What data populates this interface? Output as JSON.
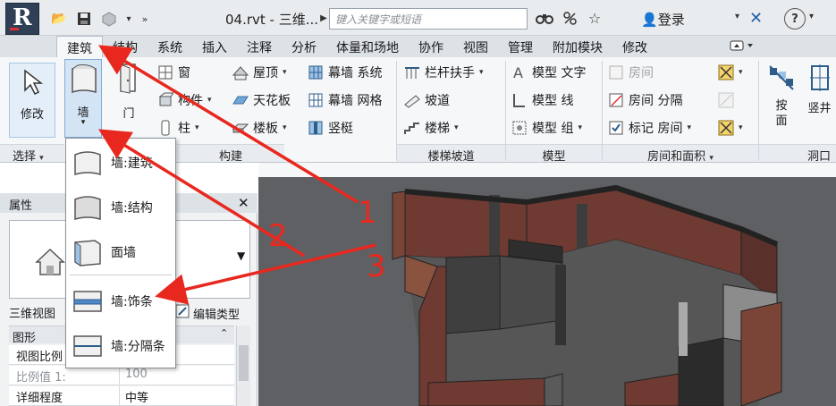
{
  "titlebar": {
    "logo_letter": "R",
    "doc_title": "04.rvt - 三维...",
    "search_placeholder": "键入关键字或短语",
    "login_label": "登录",
    "help_label": "?"
  },
  "tabs": [
    "建筑",
    "结构",
    "系统",
    "插入",
    "注释",
    "分析",
    "体量和场地",
    "协作",
    "视图",
    "管理",
    "附加模块",
    "修改"
  ],
  "active_tab": "建筑",
  "ribbon": {
    "modify_label": "修改",
    "wall_label": "墙",
    "door_label": "门",
    "build_items": {
      "window": "窗",
      "component": "构件",
      "column": "柱",
      "roof": "屋顶",
      "ceiling": "天花板",
      "floor": "楼板",
      "curtain_system": "幕墙 系统",
      "curtain_grid": "幕墙 网格",
      "mullion": "竖梃"
    },
    "stair_items": {
      "railing": "栏杆扶手",
      "ramp": "坡道",
      "stair": "楼梯"
    },
    "model_items": {
      "text": "模型 文字",
      "line": "模型 线",
      "group": "模型 组"
    },
    "room_items": {
      "room": "房间",
      "separator": "房间 分隔",
      "tag": "标记 房间"
    },
    "opening_items": {
      "by_face": "按\n面",
      "shaft": "竖井"
    },
    "panels": {
      "select": "选择",
      "build": "构建",
      "circulation": "楼梯坡道",
      "model": "模型",
      "room_area": "房间和面积",
      "opening": "洞口"
    }
  },
  "wall_menu": [
    {
      "label": "墙:建筑"
    },
    {
      "label": "墙:结构"
    },
    {
      "label": "面墙"
    },
    {
      "label": "墙:饰条"
    },
    {
      "label": "墙:分隔条"
    }
  ],
  "properties": {
    "title": "属性",
    "view_type": "三维视图",
    "edit_type": "编辑类型",
    "group": "图形",
    "rows": [
      {
        "key": "视图比例",
        "value": ""
      },
      {
        "key": "比例值 1:",
        "value": "100"
      },
      {
        "key": "详细程度",
        "value": "中等"
      }
    ]
  },
  "annotations": [
    "1",
    "2",
    "3"
  ],
  "colors": {
    "arrow": "#e8281e",
    "wall_brown": "#6e3a32",
    "wall_light": "#d8d8d8"
  }
}
